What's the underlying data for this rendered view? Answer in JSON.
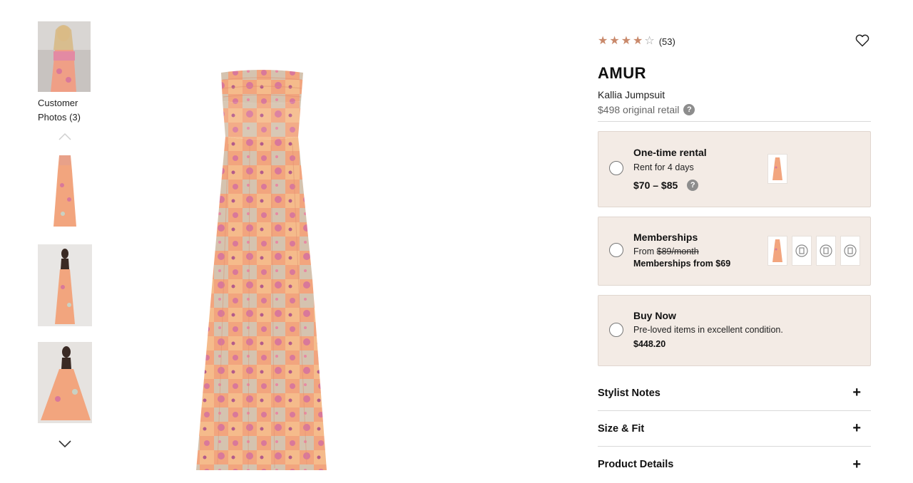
{
  "gallery": {
    "customer_photos_label": "Customer Photos (3)",
    "prev_icon": "chevron-up-icon",
    "next_icon": "chevron-down-icon"
  },
  "product": {
    "rating": 4,
    "rating_max": 5,
    "review_count": "(53)",
    "brand": "AMUR",
    "name": "Kallia Jumpsuit",
    "retail": "$498 original retail",
    "favorite_icon": "heart-icon",
    "help_icon": "?"
  },
  "options": {
    "rental": {
      "title": "One-time rental",
      "sub": "Rent for 4 days",
      "price": "$70 – $85",
      "help_icon": "?"
    },
    "membership": {
      "title": "Memberships",
      "from_label": "From",
      "old_price": "$89/month",
      "new_price": "Memberships from $69"
    },
    "buy": {
      "title": "Buy Now",
      "sub": "Pre-loved items in excellent condition.",
      "price": "$448.20"
    }
  },
  "accordion": [
    {
      "label": "Stylist Notes",
      "icon": "+"
    },
    {
      "label": "Size & Fit",
      "icon": "+"
    },
    {
      "label": "Product Details",
      "icon": "+"
    }
  ],
  "colors": {
    "accent_star": "#c9896b",
    "option_bg": "#f3ebe5",
    "dress_peach": "#f2a57e",
    "dress_pink": "#d9789a",
    "dress_sage": "#c9d1c3"
  }
}
